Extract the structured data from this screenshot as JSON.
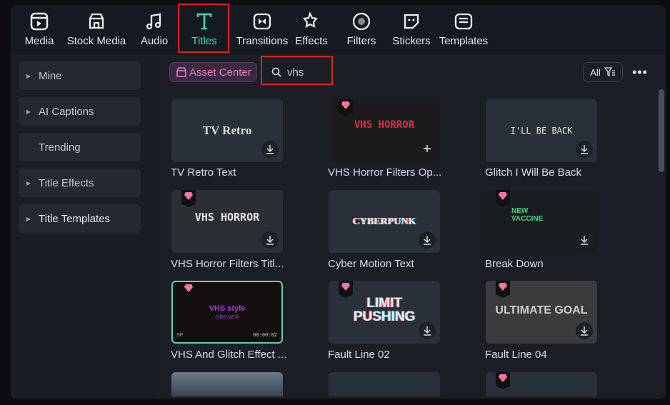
{
  "tabs": [
    {
      "label": "Media",
      "icon": "media-icon"
    },
    {
      "label": "Stock Media",
      "icon": "stock-media-icon"
    },
    {
      "label": "Audio",
      "icon": "music-note-icon"
    },
    {
      "label": "Titles",
      "icon": "title-t-icon",
      "active": true
    },
    {
      "label": "Transitions",
      "icon": "transitions-icon"
    },
    {
      "label": "Effects",
      "icon": "effects-icon"
    },
    {
      "label": "Filters",
      "icon": "filters-icon"
    },
    {
      "label": "Stickers",
      "icon": "stickers-icon"
    },
    {
      "label": "Templates",
      "icon": "templates-icon"
    }
  ],
  "sidebar": {
    "items": [
      {
        "label": "Mine"
      },
      {
        "label": "AI Captions"
      },
      {
        "label": "Trending"
      },
      {
        "label": "Title Effects"
      },
      {
        "label": "Title Templates"
      }
    ]
  },
  "toolbar": {
    "asset_center": "Asset Center",
    "search_value": "vhs",
    "filter_label": "All"
  },
  "cards": [
    {
      "label": "TV Retro Text",
      "thumb": "TV Retro"
    },
    {
      "label": "VHS Horror Filters Op...",
      "thumb": "VHS HORROR"
    },
    {
      "label": "Glitch I Will Be Back",
      "thumb": "I'LL BE BACK"
    },
    {
      "label": "VHS Horror Filters Titl...",
      "thumb": "VHS HORROR"
    },
    {
      "label": "Cyber Motion Text",
      "thumb": "CYBERPUNK"
    },
    {
      "label": "Break Down",
      "thumb": "NEW VACCINE"
    },
    {
      "label": "VHS And Glitch Effect ...",
      "thumb": "VHS style",
      "thumb_sub": "OPENER",
      "thumb_time": "00:00:02",
      "thumb_corner": "SP"
    },
    {
      "label": "Fault Line 02",
      "thumb": "LIMIT PUSHING"
    },
    {
      "label": "Fault Line 04",
      "thumb": "ULTIMATE GOAL"
    }
  ],
  "colors": {
    "accent": "#4fd1b4",
    "asset_pink": "#f07ad0",
    "premium_gem": "#ff6fa8"
  }
}
